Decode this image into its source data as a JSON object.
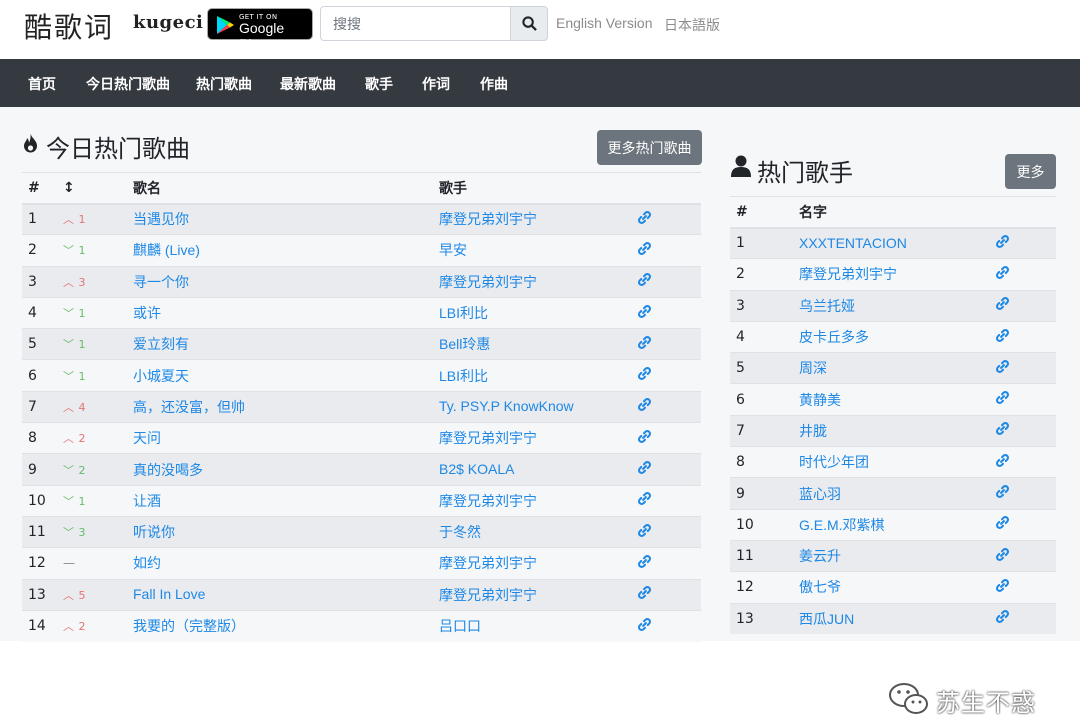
{
  "header": {
    "logo_cn": "酷歌词",
    "logo_en": "kugeci",
    "gplay_getit": "GET IT ON",
    "gplay_name": "Google Play",
    "search_placeholder": "搜搜",
    "lang_en": "English Version",
    "lang_jp": "日本語版"
  },
  "nav": [
    "首页",
    "今日热门歌曲",
    "热门歌曲",
    "最新歌曲",
    "歌手",
    "作词",
    "作曲"
  ],
  "songs_panel": {
    "title": "今日热门歌曲",
    "more_button": "更多热门歌曲",
    "col_rank": "#",
    "col_trend": "↕",
    "col_name": "歌名",
    "col_artist": "歌手",
    "rows": [
      {
        "rank": "1",
        "trend": "^",
        "change": "1",
        "dir": "up",
        "name": "当遇见你",
        "artist": "摩登兄弟刘宇宁"
      },
      {
        "rank": "2",
        "trend": "v",
        "change": "1",
        "dir": "down",
        "name": "麒麟 (Live)",
        "artist": "早安"
      },
      {
        "rank": "3",
        "trend": "^",
        "change": "3",
        "dir": "up",
        "name": "寻一个你",
        "artist": "摩登兄弟刘宇宁"
      },
      {
        "rank": "4",
        "trend": "v",
        "change": "1",
        "dir": "down",
        "name": "或许",
        "artist": "LBI利比"
      },
      {
        "rank": "5",
        "trend": "v",
        "change": "1",
        "dir": "down",
        "name": "爱立刻有",
        "artist": "Bell玲惠"
      },
      {
        "rank": "6",
        "trend": "v",
        "change": "1",
        "dir": "down",
        "name": "小城夏天",
        "artist": "LBI利比"
      },
      {
        "rank": "7",
        "trend": "^",
        "change": "4",
        "dir": "up",
        "name": "高，还没富，但帅",
        "artist": "Ty.  PSY.P  KnowKnow"
      },
      {
        "rank": "8",
        "trend": "^",
        "change": "2",
        "dir": "up",
        "name": "天问",
        "artist": "摩登兄弟刘宇宁"
      },
      {
        "rank": "9",
        "trend": "v",
        "change": "2",
        "dir": "down",
        "name": "真的没喝多",
        "artist": "B2$  KOALA"
      },
      {
        "rank": "10",
        "trend": "v",
        "change": "1",
        "dir": "down",
        "name": "让酒",
        "artist": "摩登兄弟刘宇宁"
      },
      {
        "rank": "11",
        "trend": "v",
        "change": "3",
        "dir": "down",
        "name": "听说你",
        "artist": "于冬然"
      },
      {
        "rank": "12",
        "trend": "—",
        "change": "",
        "dir": "same",
        "name": "如约",
        "artist": "摩登兄弟刘宇宁"
      },
      {
        "rank": "13",
        "trend": "^",
        "change": "5",
        "dir": "up",
        "name": "Fall In Love",
        "artist": "摩登兄弟刘宇宁"
      },
      {
        "rank": "14",
        "trend": "^",
        "change": "2",
        "dir": "up",
        "name": "我要的（完整版）",
        "artist": "吕口口"
      }
    ]
  },
  "artists_panel": {
    "title": "热门歌手",
    "more_button": "更多",
    "col_rank": "#",
    "col_name": "名字",
    "rows": [
      {
        "rank": "1",
        "name": "XXXTENTACION"
      },
      {
        "rank": "2",
        "name": "摩登兄弟刘宇宁"
      },
      {
        "rank": "3",
        "name": "乌兰托娅"
      },
      {
        "rank": "4",
        "name": "皮卡丘多多"
      },
      {
        "rank": "5",
        "name": "周深"
      },
      {
        "rank": "6",
        "name": "黄静美"
      },
      {
        "rank": "7",
        "name": "井胧"
      },
      {
        "rank": "8",
        "name": "时代少年团"
      },
      {
        "rank": "9",
        "name": "蓝心羽"
      },
      {
        "rank": "10",
        "name": "G.E.M.邓紫棋"
      },
      {
        "rank": "11",
        "name": "姜云升"
      },
      {
        "rank": "12",
        "name": "傲七爷"
      },
      {
        "rank": "13",
        "name": "西瓜JUN"
      }
    ]
  },
  "watermark": "苏生不惑",
  "colors": {
    "nav_bg": "#343a40",
    "link": "#1e88e5",
    "up": "#e57373",
    "down": "#66bb6a",
    "button": "#6c757d"
  }
}
